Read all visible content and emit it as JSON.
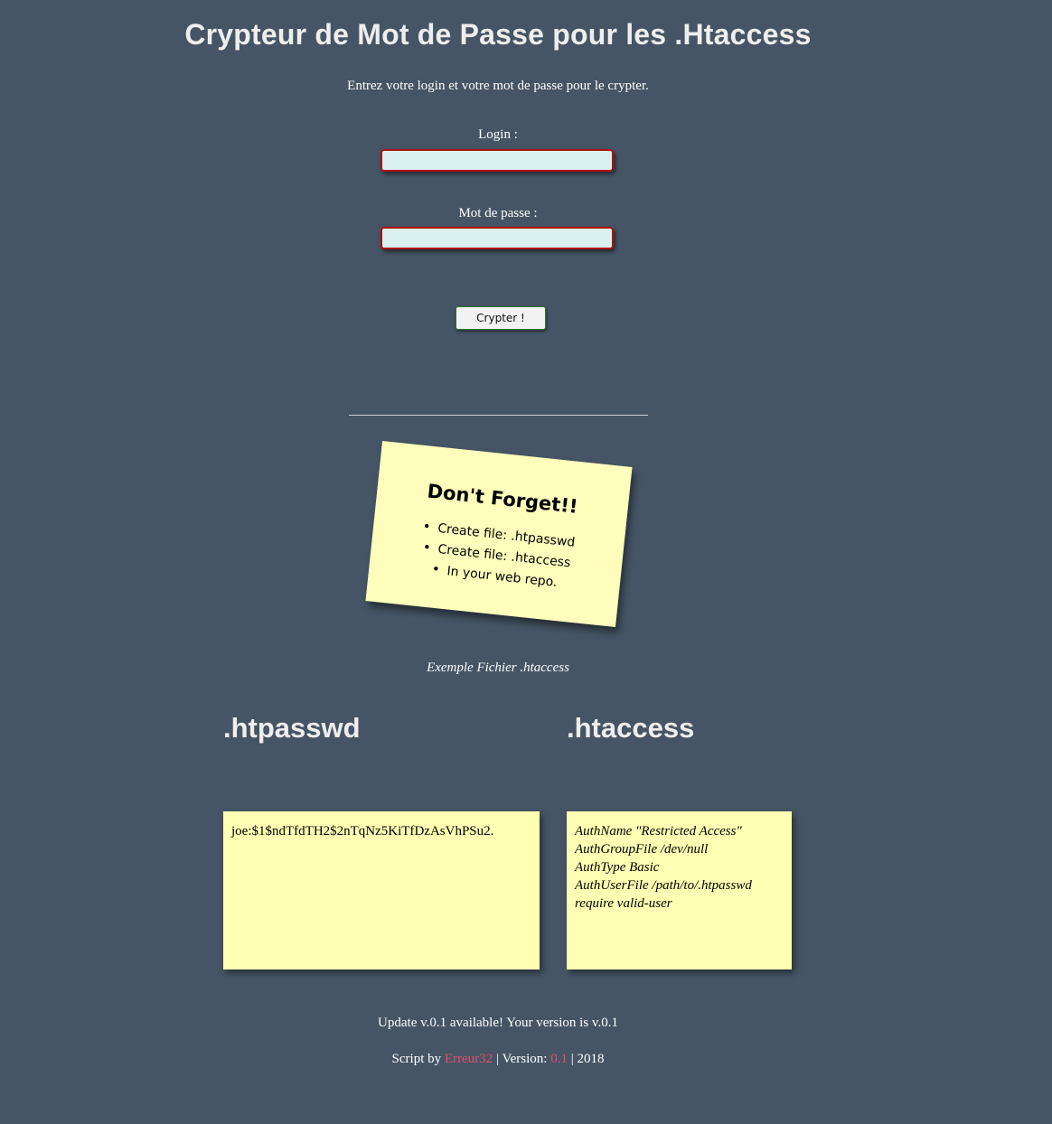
{
  "header": {
    "title": "Crypteur de Mot de Passe pour les .Htaccess",
    "intro": "Entrez votre login et votre mot de passe pour le crypter."
  },
  "form": {
    "login_label": "Login :",
    "login_value": "",
    "password_label": "Mot de passe :",
    "password_value": "",
    "submit_label": "Crypter !"
  },
  "note": {
    "title": "Don't Forget!!",
    "items": [
      "Create file: .htpasswd",
      "Create file: .htaccess",
      "In your web repo."
    ]
  },
  "example": {
    "caption": "Exemple Fichier .htaccess",
    "htpasswd": {
      "heading": ".htpasswd",
      "lines": [
        "joe:$1$ndTfdTH2$2nTqNz5KiTfDzAsVhPSu2."
      ]
    },
    "htaccess": {
      "heading": ".htaccess",
      "lines": [
        "AuthName \"Restricted Access\"",
        "AuthGroupFile /dev/null",
        "AuthType Basic",
        "AuthUserFile /path/to/.htpasswd",
        "require valid-user"
      ]
    }
  },
  "footer": {
    "update_text": "Update v.0.1 available! Your version is v.0.1",
    "script_by": "Script by",
    "author": "Erreur32",
    "sep1": "|",
    "version_label": "Version:",
    "version": "0.1",
    "sep2": "|",
    "year": "2018"
  },
  "colors": {
    "background": "#455565",
    "accent": "#e0506a",
    "sticky": "#feffb2",
    "input_bg": "#daf2ef",
    "input_border": "#b01010"
  }
}
